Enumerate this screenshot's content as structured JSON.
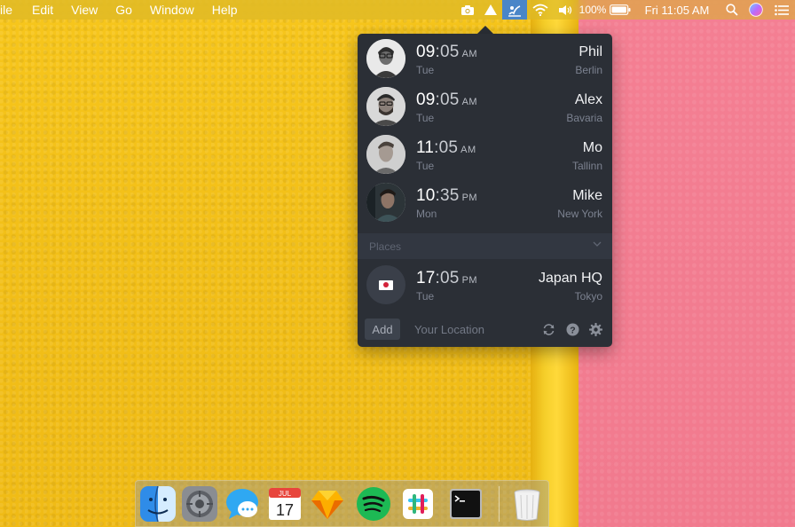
{
  "menubar": {
    "menus": [
      "ile",
      "Edit",
      "View",
      "Go",
      "Window",
      "Help"
    ],
    "battery_percent": "100%",
    "clock": "Fri 11:05 AM"
  },
  "popover": {
    "people": [
      {
        "hour": "09",
        "minutes": ":05",
        "ampm": "AM",
        "day": "Tue",
        "name": "Phil",
        "city": "Berlin"
      },
      {
        "hour": "09",
        "minutes": ":05",
        "ampm": "AM",
        "day": "Tue",
        "name": "Alex",
        "city": "Bavaria"
      },
      {
        "hour": "11",
        "minutes": ":05",
        "ampm": "AM",
        "day": "Tue",
        "name": "Mo",
        "city": "Tallinn"
      },
      {
        "hour": "10",
        "minutes": ":35",
        "ampm": "PM",
        "day": "Mon",
        "name": "Mike",
        "city": "New York"
      }
    ],
    "places_label": "Places",
    "places": [
      {
        "hour": "17",
        "minutes": ":05",
        "ampm": "PM",
        "day": "Tue",
        "name": "Japan HQ",
        "city": "Tokyo",
        "flag": "japan-flag"
      }
    ],
    "footer": {
      "add_label": "Add",
      "location_placeholder": "Your Location"
    }
  },
  "dock": {
    "apps": [
      "finder-icon",
      "system-preferences-icon",
      "messages-icon",
      "calendar-icon",
      "sketch-icon",
      "spotify-icon",
      "slack-icon",
      "terminal-icon",
      "trash-icon"
    ],
    "calendar_month": "JUL",
    "calendar_day": "17"
  },
  "colors": {
    "popover_bg": "#2b2f36",
    "active_status": "#4a86c8",
    "wall_yellow": "#f2bf18",
    "wall_pink": "#f17a8e"
  }
}
